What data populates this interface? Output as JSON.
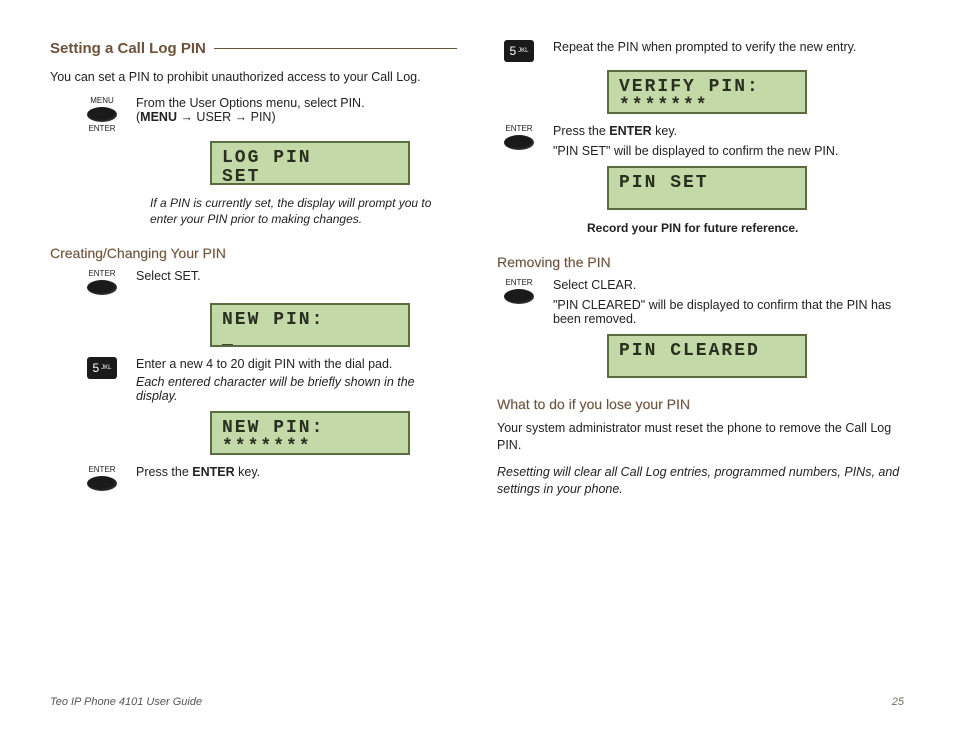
{
  "title": "Setting a Call Log PIN",
  "intro": "You can set a PIN to prohibit unauthorized access to your Call Log.",
  "menu_label_top": "MENU",
  "menu_label_bottom": "ENTER",
  "enter_label": "ENTER",
  "key5": "5",
  "key5_sub": "JKL",
  "step1_text_a": "From the User Options menu, select PIN.",
  "step1_text_b": "(MENU → USER → PIN)",
  "step1_bold": "MENU",
  "lcd1": "LOG PIN\nSET",
  "note1": "If a PIN is currently set, the display will prompt you to enter your PIN prior to making changes.",
  "sub1": "Creating/Changing Your PIN",
  "step_set": "Select SET.",
  "lcd2": "NEW PIN:\n_",
  "step_enter_pin": "Enter a new 4 to 20 digit PIN with the dial pad.",
  "note_enter": "Each entered character will be briefly shown in the display.",
  "lcd3": "NEW PIN:\n*******",
  "step_press_enter": "Press the ENTER key.",
  "step_press_enter_prefix": "Press the ",
  "step_press_enter_bold": "ENTER",
  "step_press_enter_suffix": " key.",
  "step_repeat": "Repeat the PIN when prompted to verify the new entry.",
  "lcd4": "VERIFY PIN:\n*******",
  "step_confirm": "\"PIN SET\" will be displayed to confirm the new PIN.",
  "lcd5": "PIN SET\n ",
  "record": "Record your PIN for future reference.",
  "sub2": "Removing the PIN",
  "step_clear": "Select CLEAR.",
  "step_cleared": "\"PIN CLEARED\" will be displayed to confirm that the PIN has been removed.",
  "lcd6": "PIN CLEARED\n ",
  "sub3": "What to do if you lose your PIN",
  "lose1": "Your system administrator must reset the phone to remove the Call Log PIN.",
  "lose2": "Resetting will clear all Call Log entries, programmed numbers, PINs, and settings in your phone.",
  "footer_left": "Teo IP Phone 4101 User Guide",
  "footer_right": "25"
}
